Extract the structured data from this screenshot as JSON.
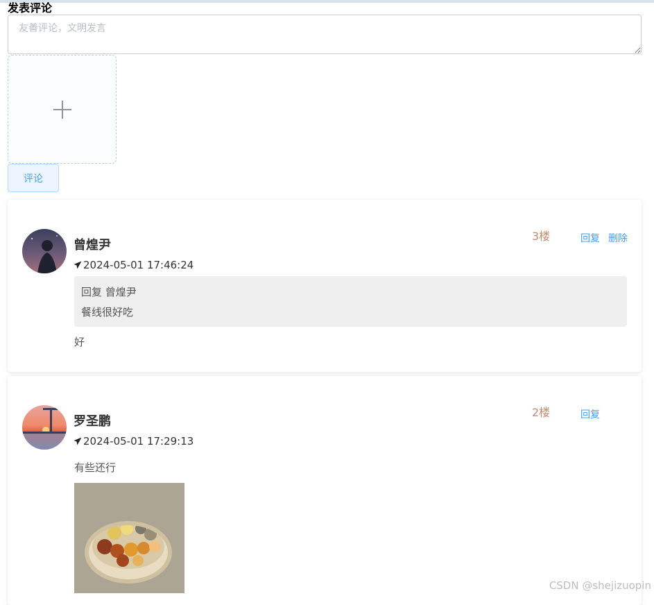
{
  "compose": {
    "title": "发表评论",
    "placeholder": "友善评论，文明发言",
    "submit_label": "评论"
  },
  "comments": [
    {
      "user": "曾煌尹",
      "time": "2024-05-01 17:46:24",
      "floor": "3楼",
      "reply_label": "回复",
      "delete_label": "删除",
      "quote": {
        "header": "回复 曾煌尹",
        "text": "餐线很好吃"
      },
      "text": "好"
    },
    {
      "user": "罗圣鹏",
      "time": "2024-05-01 17:29:13",
      "floor": "2楼",
      "reply_label": "回复",
      "text": "有些还行"
    }
  ],
  "watermark": "CSDN @shejizuopin",
  "colors": {
    "link": "#409eff",
    "floor": "#c58b6c",
    "quote_bg": "#efefef"
  }
}
